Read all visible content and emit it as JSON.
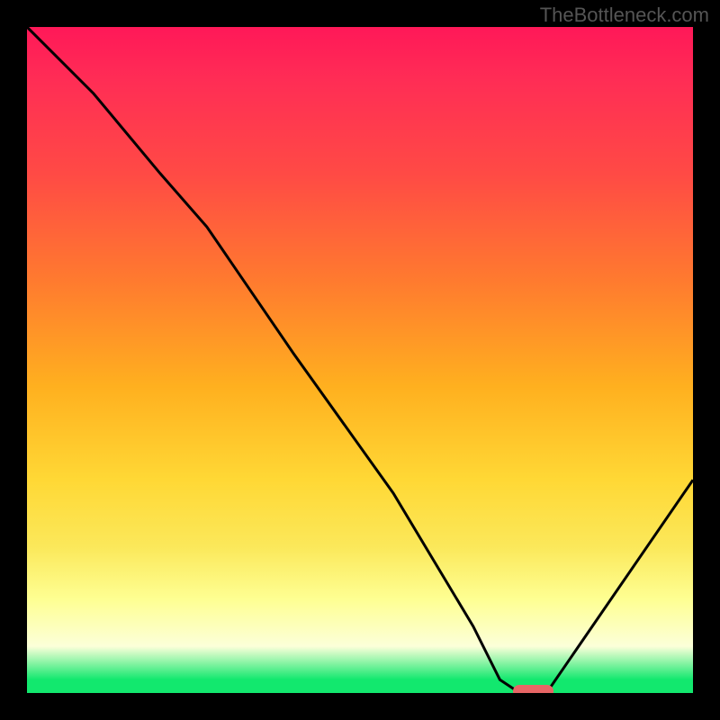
{
  "watermark": "TheBottleneck.com",
  "chart_data": {
    "type": "line",
    "title": "",
    "xlabel": "",
    "ylabel": "",
    "xlim": [
      0,
      100
    ],
    "ylim": [
      0,
      100
    ],
    "x": [
      0,
      10,
      20,
      27,
      40,
      55,
      67,
      71,
      74,
      78,
      100
    ],
    "values": [
      100,
      90,
      78,
      70,
      51,
      30,
      10,
      2,
      0,
      0,
      32
    ],
    "marker": {
      "x_start": 73,
      "x_end": 79,
      "y": 0
    }
  },
  "colors": {
    "curve": "#000000",
    "marker": "#e86666",
    "background_frame": "#000000"
  }
}
